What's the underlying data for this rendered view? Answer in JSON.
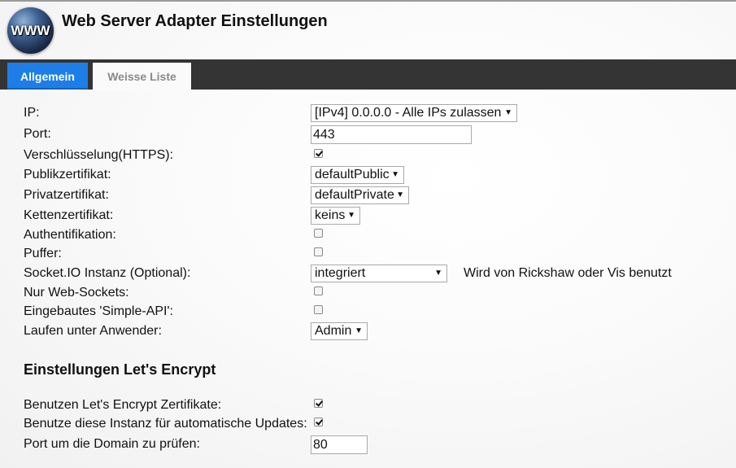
{
  "header": {
    "logo_text": "WWW",
    "title": "Web Server Adapter Einstellungen"
  },
  "tabs": [
    {
      "label": "Allgemein",
      "active": true
    },
    {
      "label": "Weisse Liste",
      "active": false
    }
  ],
  "settings": {
    "ip": {
      "label": "IP:",
      "value": "[IPv4] 0.0.0.0 - Alle IPs zulassen"
    },
    "port": {
      "label": "Port:",
      "value": "443"
    },
    "https": {
      "label": "Verschlüsselung(HTTPS):",
      "checked": true
    },
    "public_cert": {
      "label": "Publikzertifikat:",
      "value": "defaultPublic"
    },
    "private_cert": {
      "label": "Privatzertifikat:",
      "value": "defaultPrivate"
    },
    "chain_cert": {
      "label": "Kettenzertifikat:",
      "value": "keins"
    },
    "auth": {
      "label": "Authentifikation:",
      "checked": false
    },
    "buffer": {
      "label": "Puffer:",
      "checked": false
    },
    "socketio": {
      "label": "Socket.IO Instanz (Optional):",
      "value": "integriert",
      "hint": "Wird von Rickshaw oder Vis benutzt"
    },
    "websockets_only": {
      "label": "Nur Web-Sockets:",
      "checked": false
    },
    "simple_api": {
      "label": "Eingebautes 'Simple-API':",
      "checked": false
    },
    "run_as": {
      "label": "Laufen unter Anwender:",
      "value": "Admin"
    }
  },
  "letsencrypt": {
    "title": "Einstellungen Let's Encrypt",
    "use_certs": {
      "label": "Benutzen Let's Encrypt Zertifikate:",
      "checked": true
    },
    "auto_update": {
      "label": "Benutze diese Instanz für automatische Updates:",
      "checked": true
    },
    "check_port": {
      "label": "Port um die Domain zu prüfen:",
      "value": "80"
    }
  },
  "icons": {
    "dropdown_arrow": "▼"
  }
}
